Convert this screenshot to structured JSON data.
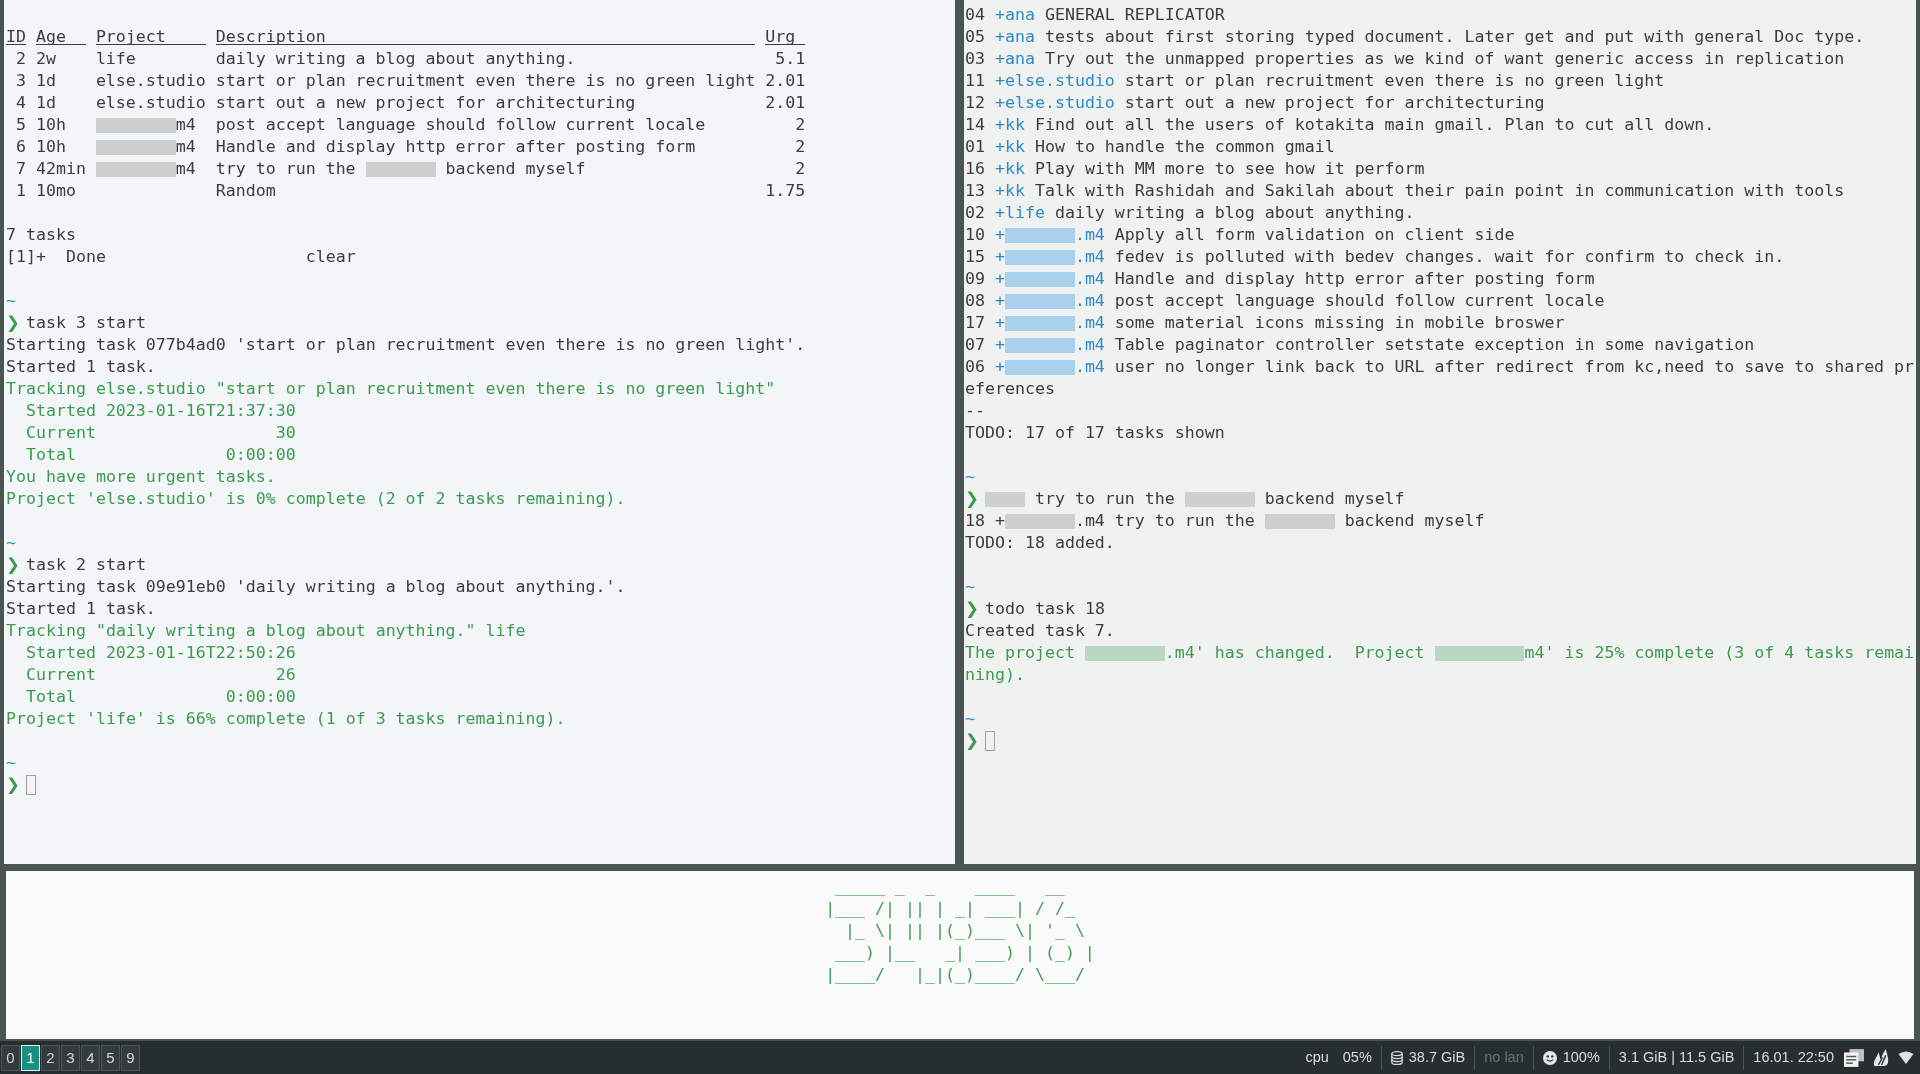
{
  "left_terminal": {
    "scrollback": [
      {
        "kind": "blank"
      },
      {
        "kind": "table",
        "columns": [
          "ID",
          "Age",
          "Project",
          "Description",
          "Urg"
        ],
        "rows": [
          {
            "id": "2",
            "age": "2w",
            "project": [
              {
                "text": "life"
              }
            ],
            "description": [
              {
                "text": "daily writing a blog about anything."
              }
            ],
            "urgency": "5.1"
          },
          {
            "id": "3",
            "age": "1d",
            "project": [
              {
                "text": "else.studio"
              }
            ],
            "description": [
              {
                "text": "start or plan recruitment even there is no green light"
              }
            ],
            "urgency": "2.01"
          },
          {
            "id": "4",
            "age": "1d",
            "project": [
              {
                "text": "else.studio"
              }
            ],
            "description": [
              {
                "text": "start out a new project for architecturing"
              }
            ],
            "urgency": "2.01"
          },
          {
            "id": "5",
            "age": "10h",
            "project": [
              {
                "kind": "hidden_project"
              },
              {
                "text": "m4"
              }
            ],
            "description": [
              {
                "text": "post accept language should follow current locale"
              }
            ],
            "urgency": "2"
          },
          {
            "id": "6",
            "age": "10h",
            "project": [
              {
                "kind": "hidden_project"
              },
              {
                "text": "m4"
              }
            ],
            "description": [
              {
                "text": "Handle and display http error after posting form"
              }
            ],
            "urgency": "2"
          },
          {
            "id": "7",
            "age": "42min",
            "project": [
              {
                "kind": "hidden_project"
              },
              {
                "text": "m4"
              }
            ],
            "description": [
              {
                "text": "try to run the "
              },
              {
                "kind": "hidden_word"
              },
              {
                "text": " backend myself"
              }
            ],
            "urgency": "2"
          },
          {
            "id": "1",
            "age": "10mo",
            "description": [
              {
                "text": "Random"
              }
            ],
            "urgency": "1.75"
          }
        ]
      },
      {
        "kind": "blank"
      },
      {
        "kind": "line",
        "segments": [
          {
            "text": "7 tasks"
          }
        ]
      },
      {
        "kind": "job",
        "job": "[1]+",
        "status": "Done",
        "command": "clear"
      }
    ],
    "sessions": [
      {
        "cwd": "~",
        "prompt": "❯",
        "command": [
          {
            "text": "task 3 start"
          }
        ],
        "cursor": false,
        "output": [
          {
            "kind": "line",
            "segments": [
              {
                "text": "Starting task 077b4ad0 'start or plan recruitment even there is no green light'."
              }
            ]
          },
          {
            "kind": "line",
            "segments": [
              {
                "text": "Started 1 task."
              }
            ]
          },
          {
            "kind": "line",
            "color": "#3d9a4f",
            "segments": [
              {
                "text": "Tracking else.studio \"start or plan recruitment even there is no green light\""
              }
            ]
          },
          {
            "kind": "summary",
            "color": "#3d9a4f",
            "rows": [
              {
                "label": "Started",
                "value": "2023-01-16T21:37:30"
              },
              {
                "label": "Current",
                "value": "30"
              },
              {
                "label": "Total",
                "value": "0:00:00"
              }
            ]
          },
          {
            "kind": "line",
            "color": "#3d9a4f",
            "segments": [
              {
                "text": "You have more urgent tasks."
              }
            ]
          },
          {
            "kind": "line",
            "color": "#3d9a4f",
            "segments": [
              {
                "text": "Project 'else.studio' is 0% complete (2 of 2 tasks remaining)."
              }
            ]
          }
        ]
      },
      {
        "cwd": "~",
        "prompt": "❯",
        "command": [
          {
            "text": "task 2 start"
          }
        ],
        "cursor": false,
        "output": [
          {
            "kind": "line",
            "segments": [
              {
                "text": "Starting task 09e91eb0 'daily writing a blog about anything.'."
              }
            ]
          },
          {
            "kind": "line",
            "segments": [
              {
                "text": "Started 1 task."
              }
            ]
          },
          {
            "kind": "line",
            "color": "#3d9a4f",
            "segments": [
              {
                "text": "Tracking \"daily writing a blog about anything.\" life"
              }
            ]
          },
          {
            "kind": "summary",
            "color": "#3d9a4f",
            "rows": [
              {
                "label": "Started",
                "value": "2023-01-16T22:50:26"
              },
              {
                "label": "Current",
                "value": "26"
              },
              {
                "label": "Total",
                "value": "0:00:00"
              }
            ]
          },
          {
            "kind": "line",
            "color": "#3d9a4f",
            "segments": [
              {
                "text": "Project 'life' is 66% complete (1 of 3 tasks remaining)."
              }
            ]
          }
        ]
      },
      {
        "cwd": "~",
        "prompt": "❯",
        "cursor": true
      }
    ]
  },
  "right_terminal": {
    "scrollback": [
      {
        "kind": "todo",
        "number": "04",
        "project": [
          {
            "text": "+ana"
          }
        ],
        "description": "GENERAL REPLICATOR"
      },
      {
        "kind": "todo",
        "number": "05",
        "project": [
          {
            "text": "+ana"
          }
        ],
        "description": "tests about first storing typed document. Later get and put with general Doc type."
      },
      {
        "kind": "todo",
        "number": "03",
        "project": [
          {
            "text": "+ana"
          }
        ],
        "description": "Try out the unmapped properties as we kind of want generic access in replication"
      },
      {
        "kind": "todo",
        "number": "11",
        "project": [
          {
            "text": "+else.studio"
          }
        ],
        "description": "start or plan recruitment even there is no green light"
      },
      {
        "kind": "todo",
        "number": "12",
        "project": [
          {
            "text": "+else.studio"
          }
        ],
        "description": "start out a new project for architecturing"
      },
      {
        "kind": "todo",
        "number": "14",
        "project": [
          {
            "text": "+kk"
          }
        ],
        "description": "Find out all the users of kotakita main gmail. Plan to cut all down."
      },
      {
        "kind": "todo",
        "number": "01",
        "project": [
          {
            "text": "+kk"
          }
        ],
        "description": "How to handle the common gmail"
      },
      {
        "kind": "todo",
        "number": "16",
        "project": [
          {
            "text": "+kk"
          }
        ],
        "description": "Play with MM more to see how it perform"
      },
      {
        "kind": "todo",
        "number": "13",
        "project": [
          {
            "text": "+kk"
          }
        ],
        "description": "Talk with Rashidah and Sakilah about their pain point in communication with tools"
      },
      {
        "kind": "todo",
        "number": "02",
        "project": [
          {
            "text": "+life"
          }
        ],
        "description": "daily writing a blog about anything."
      },
      {
        "kind": "todo",
        "number": "10",
        "project": [
          {
            "text": "+"
          },
          {
            "kind": "hidden_project"
          },
          {
            "text": ".m4"
          }
        ],
        "description": "Apply all form validation on client side"
      },
      {
        "kind": "todo",
        "number": "15",
        "project": [
          {
            "text": "+"
          },
          {
            "kind": "hidden_project"
          },
          {
            "text": ".m4"
          }
        ],
        "description": "fedev is polluted with bedev changes. wait for confirm to check in."
      },
      {
        "kind": "todo",
        "number": "09",
        "project": [
          {
            "text": "+"
          },
          {
            "kind": "hidden_project"
          },
          {
            "text": ".m4"
          }
        ],
        "description": "Handle and display http error after posting form"
      },
      {
        "kind": "todo",
        "number": "08",
        "project": [
          {
            "text": "+"
          },
          {
            "kind": "hidden_project"
          },
          {
            "text": ".m4"
          }
        ],
        "description": "post accept language should follow current locale"
      },
      {
        "kind": "todo",
        "number": "17",
        "project": [
          {
            "text": "+"
          },
          {
            "kind": "hidden_project"
          },
          {
            "text": ".m4"
          }
        ],
        "description": "some material icons missing in mobile broswer"
      },
      {
        "kind": "todo",
        "number": "07",
        "project": [
          {
            "text": "+"
          },
          {
            "kind": "hidden_project"
          },
          {
            "text": ".m4"
          }
        ],
        "description": "Table paginator controller setstate exception in some navigation"
      },
      {
        "kind": "todo",
        "number": "06",
        "project": [
          {
            "text": "+"
          },
          {
            "kind": "hidden_project"
          },
          {
            "text": ".m4"
          }
        ],
        "description": "user no longer link back to URL after redirect from kc,need to save to shared pr"
      },
      {
        "kind": "line",
        "segments": [
          {
            "text": "eferences"
          }
        ]
      },
      {
        "kind": "line",
        "segments": [
          {
            "text": "--"
          }
        ]
      },
      {
        "kind": "line",
        "segments": [
          {
            "text": "TODO: 17 of 17 tasks shown"
          }
        ]
      }
    ],
    "sessions": [
      {
        "cwd": "~",
        "prompt": "❯",
        "command": [
          {
            "kind": "hidden_command"
          },
          {
            "text": " try to run the "
          },
          {
            "kind": "hidden_word"
          },
          {
            "text": " backend myself"
          }
        ],
        "cursor": false,
        "output": [
          {
            "kind": "line",
            "segments": [
              {
                "text": "18 +"
              },
              {
                "kind": "hidden_project"
              },
              {
                "text": ".m4 try to run the "
              },
              {
                "kind": "hidden_word"
              },
              {
                "text": " backend myself"
              }
            ]
          },
          {
            "kind": "line",
            "segments": [
              {
                "text": "TODO: 18 added."
              }
            ]
          }
        ]
      },
      {
        "cwd": "~",
        "prompt": "❯",
        "command": [
          {
            "text": "todo task 18"
          }
        ],
        "cursor": false,
        "output": [
          {
            "kind": "line",
            "segments": [
              {
                "text": "Created task 7."
              }
            ]
          },
          {
            "kind": "line",
            "color": "#3d9a4f",
            "segments": [
              {
                "text": "The project "
              },
              {
                "kind": "hidden_quoted"
              },
              {
                "text": ".m4' has changed.  Project "
              },
              {
                "kind": "hidden_quoted_dot"
              },
              {
                "text": "m4' is 25% complete (3 of 4 tasks remai"
              }
            ]
          },
          {
            "kind": "line",
            "color": "#3d9a4f",
            "segments": [
              {
                "text": "ning)."
              }
            ]
          }
        ]
      },
      {
        "cwd": "~",
        "prompt": "❯",
        "cursor": true
      }
    ]
  },
  "banner": {
    "lines": [
      " _____ _  _    ____   __",
      "|___ /| || | _| ___| / /_",
      "  |_ \\| || |(_)___ \\| '_ \\",
      " ___) |__   _| ___) | (_) |",
      "|____/   |_|(_)____/ \\___/"
    ]
  },
  "status_bar": {
    "workspaces": [
      {
        "label": "0",
        "selected": false
      },
      {
        "label": "1",
        "selected": true
      },
      {
        "label": "2",
        "selected": false
      },
      {
        "label": "3",
        "selected": false
      },
      {
        "label": "4",
        "selected": false
      },
      {
        "label": "5",
        "selected": false
      },
      {
        "label": "9",
        "selected": false
      }
    ],
    "items": [
      {
        "kind": "cpu",
        "label": "cpu",
        "value": "05%"
      },
      {
        "kind": "disk",
        "value": "38.7 GiB"
      },
      {
        "kind": "network",
        "value": "no lan",
        "connected": false
      },
      {
        "kind": "indicator",
        "value": "100%"
      },
      {
        "kind": "memory",
        "value": "3.1 GiB | 11.5 GiB"
      },
      {
        "kind": "clock",
        "value": "16.01. 22:50"
      }
    ]
  }
}
